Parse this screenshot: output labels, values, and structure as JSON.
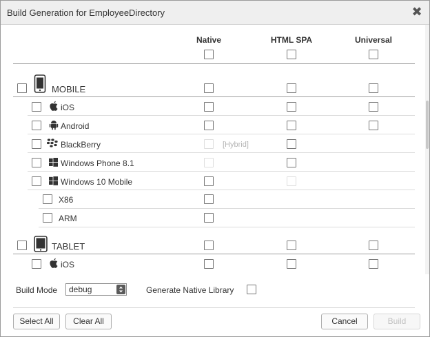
{
  "dialog": {
    "title": "Build Generation for EmployeeDirectory",
    "close_glyph": "✖"
  },
  "columns": {
    "native": "Native",
    "html_spa": "HTML SPA",
    "universal": "Universal"
  },
  "rows": {
    "mobile": "MOBILE",
    "ios": "iOS",
    "android": "Android",
    "blackberry": "BlackBerry",
    "hybrid": "[Hybrid]",
    "windows_phone": "Windows Phone 8.1",
    "windows_10_mobile": "Windows 10 Mobile",
    "x86": "X86",
    "arm": "ARM",
    "tablet": "TABLET",
    "tablet_ios": "iOS"
  },
  "footer": {
    "build_mode_label": "Build Mode",
    "build_mode_value": "debug",
    "generate_native_library_label": "Generate Native Library",
    "select_all": "Select All",
    "clear_all": "Clear All",
    "cancel": "Cancel",
    "build": "Build"
  },
  "colors": {
    "title_bar": "#efefef",
    "border": "#9a9a9a",
    "disabled_text": "#b5b5b5"
  },
  "icons": {
    "close": "close-icon",
    "phone": "mobile-phone-icon",
    "tablet": "tablet-icon",
    "apple": "apple-icon",
    "android": "android-icon",
    "blackberry": "blackberry-icon",
    "windows": "windows-icon",
    "dropdown": "dropdown-arrows-icon"
  }
}
